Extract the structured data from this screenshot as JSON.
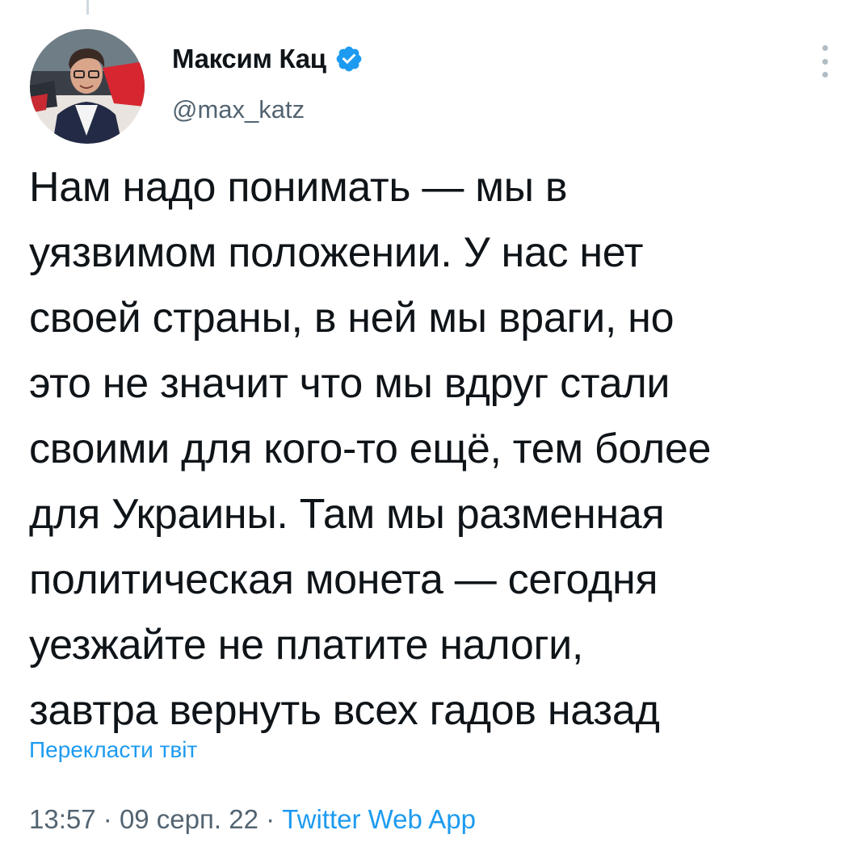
{
  "tweet": {
    "author": {
      "display_name": "Максим Кац",
      "username": "@max_katz",
      "verified": true
    },
    "text_lines": [
      "Нам надо понимать — мы в",
      "уязвимом положении. У нас нет",
      "своей страны, в ней мы враги, но",
      "это не значит что мы вдруг стали",
      "своими для кого-то ещё, тем более",
      "для Украины. Там мы разменная",
      "политическая монета — сегодня",
      "уезжайте не платите налоги,",
      "завтра вернуть всех гадов назад"
    ],
    "translate_label": "Перекласти твіт",
    "meta": {
      "time": "13:57",
      "separator": "·",
      "date": "09 серп. 22",
      "source": "Twitter Web App"
    }
  },
  "colors": {
    "text": "#0f1419",
    "secondary": "#536471",
    "accent": "#1d9bf0"
  },
  "icons": {
    "verified": "verified-badge-icon",
    "more": "more-options-icon"
  }
}
